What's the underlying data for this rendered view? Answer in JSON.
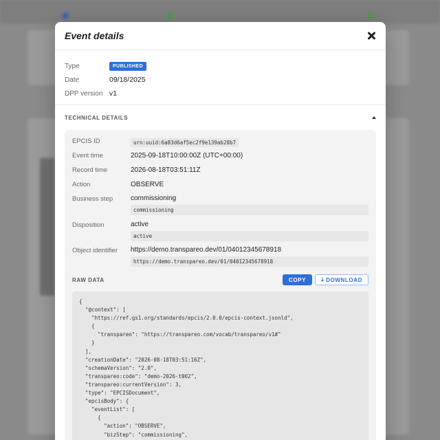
{
  "modal": {
    "title": "Event details"
  },
  "summary": {
    "type_label": "Type",
    "type_badge": "PUBLISHED",
    "date_label": "Date",
    "date_value": "09/18/2025",
    "version_label": "DPP version",
    "version_value": "v1"
  },
  "technical": {
    "heading": "TECHNICAL DETAILS",
    "epcis_id_label": "EPCIS ID",
    "epcis_id_value": "urn:uuid:6a83d6af5ec2f9e139ab28b7",
    "event_time_label": "Event time",
    "event_time_value": "2025-09-18T10:00:00Z (UTC+00:00)",
    "record_time_label": "Record time",
    "record_time_value": "2026-08-18T03:51:11Z",
    "action_label": "Action",
    "action_value": "OBSERVE",
    "business_step_label": "Business step",
    "business_step_value": "commissioning",
    "business_step_code": "commissioning",
    "disposition_label": "Disposition",
    "disposition_value": "active",
    "disposition_code": "active",
    "object_id_label": "Object identifier",
    "object_id_value": "https://demo.transpareo.dev/01/04012345678918",
    "object_id_code": "https://demo.transpareo.dev/01/04012345678918"
  },
  "raw": {
    "heading": "RAW DATA",
    "copy_label": "COPY",
    "download_label": "DOWNLOAD",
    "json_text": "{\n  \"@context\": [\n    \"https://ref.gs1.org/standards/epcis/2.0.0/epcis-context.jsonld\",\n    {\n      \"transpareo\": \"https://transpareo.com/vocab/transpareo/v1#\"\n    }\n  ],\n  \"creationDate\": \"2026-08-18T03:51:16Z\",\n  \"schemaVersion\": \"2.0\",\n  \"transpareo:code\": \"demo-2026-t002\",\n  \"transpareo:currentVersion\": 3,\n  \"type\": \"EPCISDocument\",\n  \"epcisBody\": {\n    \"eventList\": [\n      {\n        \"action\": \"OBSERVE\",\n        \"bizStep\": \"commissioning\",\n        \"disposition\": \"active\","
  },
  "colors": {
    "accent": "#2f6fd6",
    "overlay": "#8a8a8a"
  },
  "icons": {
    "close": "close-icon",
    "collapse": "caret-up-icon",
    "download": "download-icon"
  }
}
